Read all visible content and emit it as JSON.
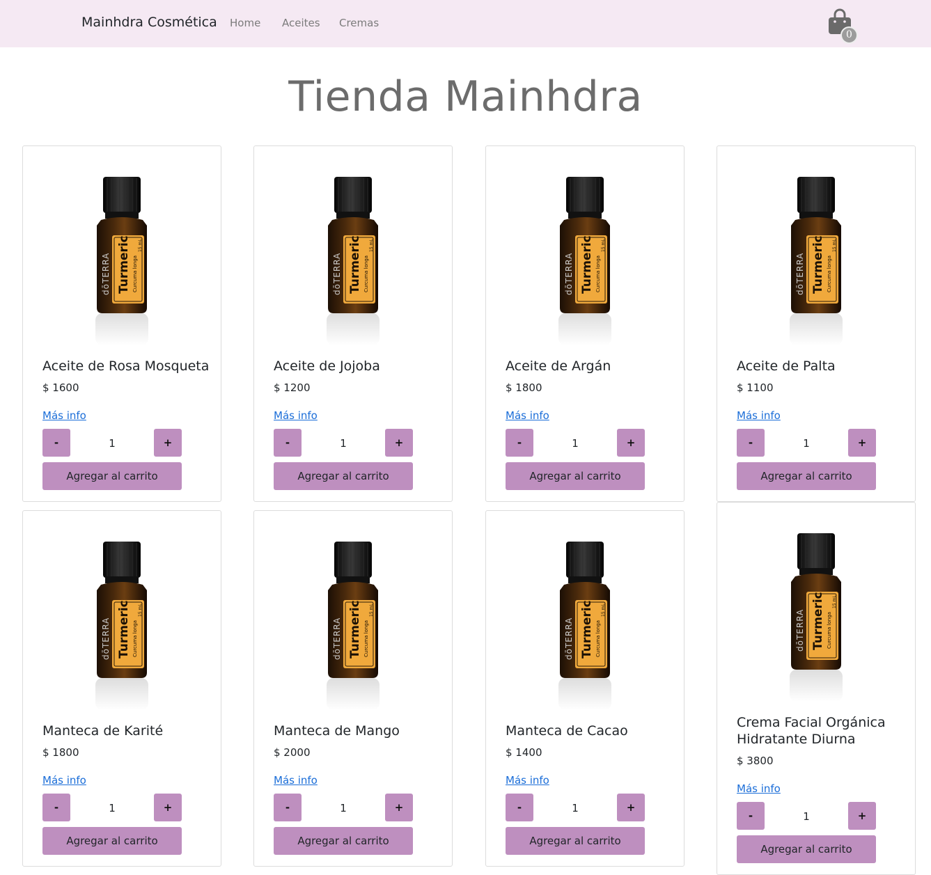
{
  "nav": {
    "brand": "Mainhdra Cosmética",
    "links": [
      "Home",
      "Aceites",
      "Cremas"
    ],
    "cart_count": "0",
    "cart_icon": "shopping-bag-icon"
  },
  "page": {
    "title": "Tienda Mainhdra"
  },
  "products": [
    {
      "name": "Aceite de Rosa Mosqueta",
      "price": "$ 1600",
      "more_info": "Más info",
      "minus": "-",
      "qty": "1",
      "plus": "+",
      "add_label": "Agregar al carrito"
    },
    {
      "name": "Aceite de Jojoba",
      "price": "$ 1200",
      "more_info": "Más info",
      "minus": "-",
      "qty": "1",
      "plus": "+",
      "add_label": "Agregar al carrito"
    },
    {
      "name": "Aceite de Argán",
      "price": "$ 1800",
      "more_info": "Más info",
      "minus": "-",
      "qty": "1",
      "plus": "+",
      "add_label": "Agregar al carrito"
    },
    {
      "name": "Aceite de Palta",
      "price": "$ 1100",
      "more_info": "Más info",
      "minus": "-",
      "qty": "1",
      "plus": "+",
      "add_label": "Agregar al carrito"
    },
    {
      "name": "Manteca de Karité",
      "price": "$ 1800",
      "more_info": "Más info",
      "minus": "-",
      "qty": "1",
      "plus": "+",
      "add_label": "Agregar al carrito"
    },
    {
      "name": "Manteca de Mango",
      "price": "$ 2000",
      "more_info": "Más info",
      "minus": "-",
      "qty": "1",
      "plus": "+",
      "add_label": "Agregar al carrito"
    },
    {
      "name": "Manteca de Cacao",
      "price": "$ 1400",
      "more_info": "Más info",
      "minus": "-",
      "qty": "1",
      "plus": "+",
      "add_label": "Agregar al carrito"
    },
    {
      "name": "Crema Facial Orgánica Hidratante Diurna",
      "price": "$ 3800",
      "more_info": "Más info",
      "minus": "-",
      "qty": "1",
      "plus": "+",
      "add_label": "Agregar al carrito"
    }
  ],
  "product_image": {
    "label_big": "Turmeric",
    "label_brand": "dōTERRA",
    "label_small": "Curcuma longa",
    "label_ml": "15 mL"
  },
  "colors": {
    "navbar": "#f5e9f3",
    "button": "#be8fbf",
    "link": "#1a6dd8",
    "title": "#6c6c6c"
  }
}
